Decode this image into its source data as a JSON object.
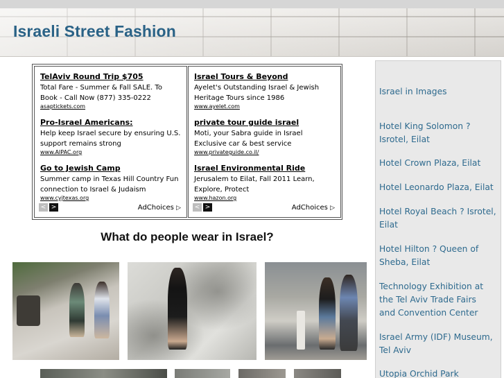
{
  "site": {
    "title": "Israeli Street Fashion"
  },
  "ads": {
    "left": [
      {
        "title": "TelAviv Round Trip $705",
        "desc": "Total Fare - Summer & Fall SALE. To Book - Call Now (877) 335-0222",
        "url": "asaptickets.com"
      },
      {
        "title": "Pro-Israel Americans:",
        "desc": "Help keep Israel secure by ensuring U.S. support remains strong",
        "url": "www.AIPAC.org"
      },
      {
        "title": "Go to Jewish Camp",
        "desc": "Summer camp in Texas Hill Country Fun connection to Israel & Judaism",
        "url": "www.cyjtexas.org"
      }
    ],
    "right": [
      {
        "title": "Israel Tours & Beyond",
        "desc": "Ayelet's Outstanding Israel & Jewish Heritage Tours since 1986",
        "url": "www.ayelet.com"
      },
      {
        "title": "private tour guide israel",
        "desc": "Moti, your Sabra guide in Israel Exclusive car & best service",
        "url": "www.privateguide.co.il/"
      },
      {
        "title": "Israel Environmental Ride",
        "desc": "Jerusalem to Eilat, Fall 2011 Learn, Explore, Protect",
        "url": "www.hazon.org"
      }
    ],
    "adchoices_label": "AdChoices",
    "prev_glyph": "<",
    "next_glyph": ">",
    "adchoices_glyph": "▷"
  },
  "main": {
    "question": "What do people wear in Israel?"
  },
  "sidebar": {
    "links": [
      "Israel in Images",
      "Hotel King Solomon ? Isrotel, Eilat",
      "Hotel Crown Plaza, Eilat",
      "Hotel Leonardo Plaza, Eilat",
      "Hotel Royal Beach ? Isrotel, Eilat",
      "Hotel Hilton ? Queen of Sheba, Eilat",
      "Technology Exhibition at the Tel Aviv Trade Fairs and Convention Center",
      "Israel Army (IDF) Museum, Tel Aviv",
      "Utopia Orchid Park"
    ]
  },
  "colors": {
    "title": "#2a6286",
    "link": "#2e6a8e",
    "sidebar_bg": "#e9e9e9"
  }
}
